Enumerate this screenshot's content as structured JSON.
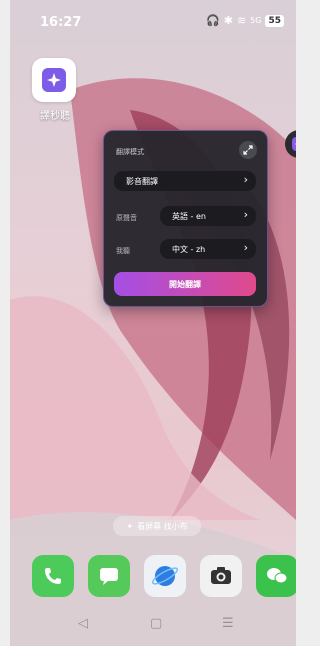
{
  "status_bar": {
    "time": "16:27",
    "signal_label": "5G",
    "battery": "55"
  },
  "home_app": {
    "label": "譯秒聽"
  },
  "translate_panel": {
    "title": "翻譯模式",
    "mode_value": "影音翻譯",
    "source_label": "原聲音",
    "source_value": "英語 - en",
    "target_label": "我聽",
    "target_value": "中文 - zh",
    "start_label": "開始翻譯"
  },
  "assistant_hint": {
    "label": "看屏幕 找小布"
  },
  "dock": {
    "apps": [
      "phone-icon",
      "messages-icon",
      "browser-icon",
      "camera-icon",
      "wechat-icon"
    ]
  },
  "navbar": {
    "back": "◁",
    "home": "▢",
    "menu": "☰"
  },
  "colors": {
    "panel_bg": "#26262c",
    "start_gradient_from": "#a54ee6",
    "start_gradient_to": "#e04a8c"
  }
}
